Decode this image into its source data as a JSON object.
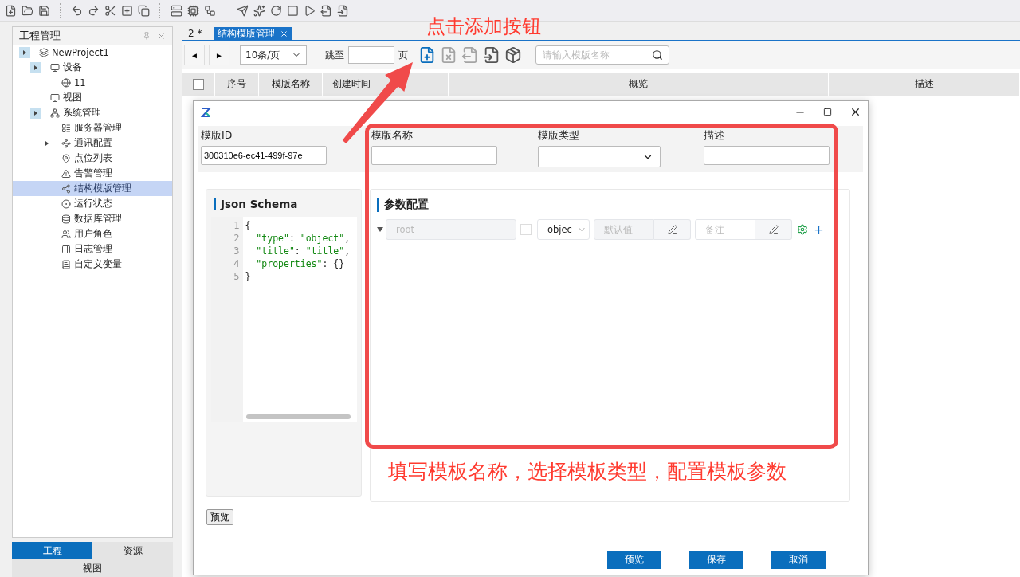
{
  "project_panel": {
    "title": "工程管理",
    "tree": [
      {
        "label": "NewProject1",
        "expandable": true,
        "selected": false,
        "children": [
          {
            "label": "设备",
            "expandable": true,
            "selected": false,
            "children": [
              {
                "label": "11",
                "expandable": false,
                "selected": false
              }
            ]
          },
          {
            "label": "视图",
            "expandable": false,
            "selected": false
          },
          {
            "label": "系统管理",
            "expandable": true,
            "selected": false,
            "children": [
              {
                "label": "服务器管理",
                "expandable": false,
                "selected": false
              },
              {
                "label": "通讯配置",
                "expandable": true,
                "selected": false
              },
              {
                "label": "点位列表",
                "expandable": false,
                "selected": false
              },
              {
                "label": "告警管理",
                "expandable": false,
                "selected": false
              },
              {
                "label": "结构模版管理",
                "expandable": false,
                "selected": true
              },
              {
                "label": "运行状态",
                "expandable": false,
                "selected": false
              },
              {
                "label": "数据库管理",
                "expandable": false,
                "selected": false
              },
              {
                "label": "用户角色",
                "expandable": false,
                "selected": false
              },
              {
                "label": "日志管理",
                "expandable": false,
                "selected": false
              },
              {
                "label": "自定义变量",
                "expandable": false,
                "selected": false
              }
            ]
          }
        ]
      }
    ],
    "bottom_tabs": [
      {
        "label": "工程",
        "selected": true
      },
      {
        "label": "资源",
        "selected": false
      },
      {
        "label": "视图",
        "selected": false
      }
    ]
  },
  "document_tabs": [
    {
      "label": "2 *",
      "selected": false
    },
    {
      "label": "结构模版管理",
      "selected": true
    }
  ],
  "pager": {
    "prev": "◄",
    "next": "►",
    "page_size": "10条/页",
    "jump_label": "跳至",
    "page_unit": "页",
    "search_placeholder": "请输入模版名称"
  },
  "table": {
    "select_all": {
      "checked": false
    },
    "columns": [
      "序号",
      "模版名称",
      "创建时间",
      "概览",
      "描述"
    ]
  },
  "dialog": {
    "fields": [
      {
        "kind": "text",
        "label": "模版ID",
        "value": "300310e6-ec41-499f-97e"
      },
      {
        "kind": "text",
        "label": "模版名称"
      },
      {
        "kind": "select",
        "label": "模版类型"
      },
      {
        "kind": "text",
        "label": "描述"
      }
    ],
    "json_schema": {
      "title": "Json Schema",
      "lines": [
        {
          "number": "1",
          "text": "{"
        },
        {
          "number": "2",
          "text": "  \"type\": \"object\","
        },
        {
          "number": "3",
          "text": "  \"title\": \"title\","
        },
        {
          "number": "4",
          "text": "  \"properties\": {}"
        },
        {
          "number": "5",
          "text": "}"
        }
      ]
    },
    "params": {
      "title": "参数配置",
      "rows": [
        {
          "name_placeholder": "root",
          "required": false,
          "type": "objec",
          "default_placeholder": "默认值",
          "note_placeholder": "备注"
        }
      ]
    },
    "preview_small": "预览",
    "buttons": [
      "预览",
      "保存",
      "取消"
    ]
  },
  "annotations": [
    "点击添加按钮",
    "填写模板名称，选择模板类型，配置模板参数"
  ]
}
